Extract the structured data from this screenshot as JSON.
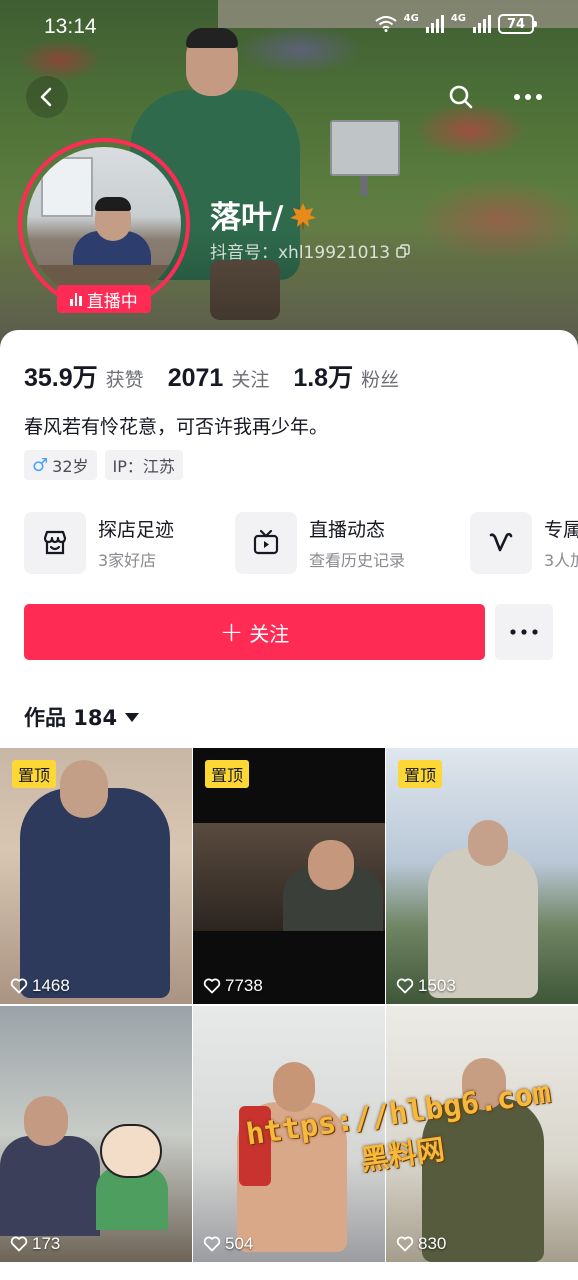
{
  "status_bar": {
    "time": "13:14",
    "network_1": "4G",
    "network_2": "4G",
    "battery": "74"
  },
  "nav": {
    "back_icon": "chevron-left-icon",
    "search_icon": "search-icon",
    "more_icon": "more-horizontal-icon"
  },
  "profile": {
    "live_badge": "直播中",
    "nickname": "落叶/",
    "douyin_id": "抖音号：xhl19921013",
    "stats": [
      {
        "value": "35.9万",
        "label": "获赞"
      },
      {
        "value": "2071",
        "label": "关注"
      },
      {
        "value": "1.8万",
        "label": "粉丝"
      }
    ],
    "bio": "春风若有怜花意，可否许我再少年。",
    "tags": {
      "age": "32岁",
      "ip": "IP：江苏"
    },
    "features": [
      {
        "title": "探店足迹",
        "subtitle": "3家好店",
        "icon": "shop-icon"
      },
      {
        "title": "直播动态",
        "subtitle": "查看历史记录",
        "icon": "tv-icon"
      },
      {
        "title": "专属",
        "subtitle": "3人加",
        "icon": "v-icon"
      }
    ],
    "follow_label": "关注",
    "works_label": "作品 184"
  },
  "videos": [
    {
      "pinned": "置顶",
      "likes": "1468"
    },
    {
      "pinned": "置顶",
      "likes": "7738"
    },
    {
      "pinned": "置顶",
      "likes": "1503"
    },
    {
      "pinned": "",
      "likes": "173"
    },
    {
      "pinned": "",
      "likes": "504"
    },
    {
      "pinned": "",
      "likes": "830"
    }
  ],
  "watermark": {
    "url": "https://hlbg6.com",
    "name": "黑料网"
  },
  "colors": {
    "accent": "#fe2c55",
    "pin": "#fdd735",
    "text_primary": "#161823",
    "text_secondary": "#6e6f76"
  }
}
